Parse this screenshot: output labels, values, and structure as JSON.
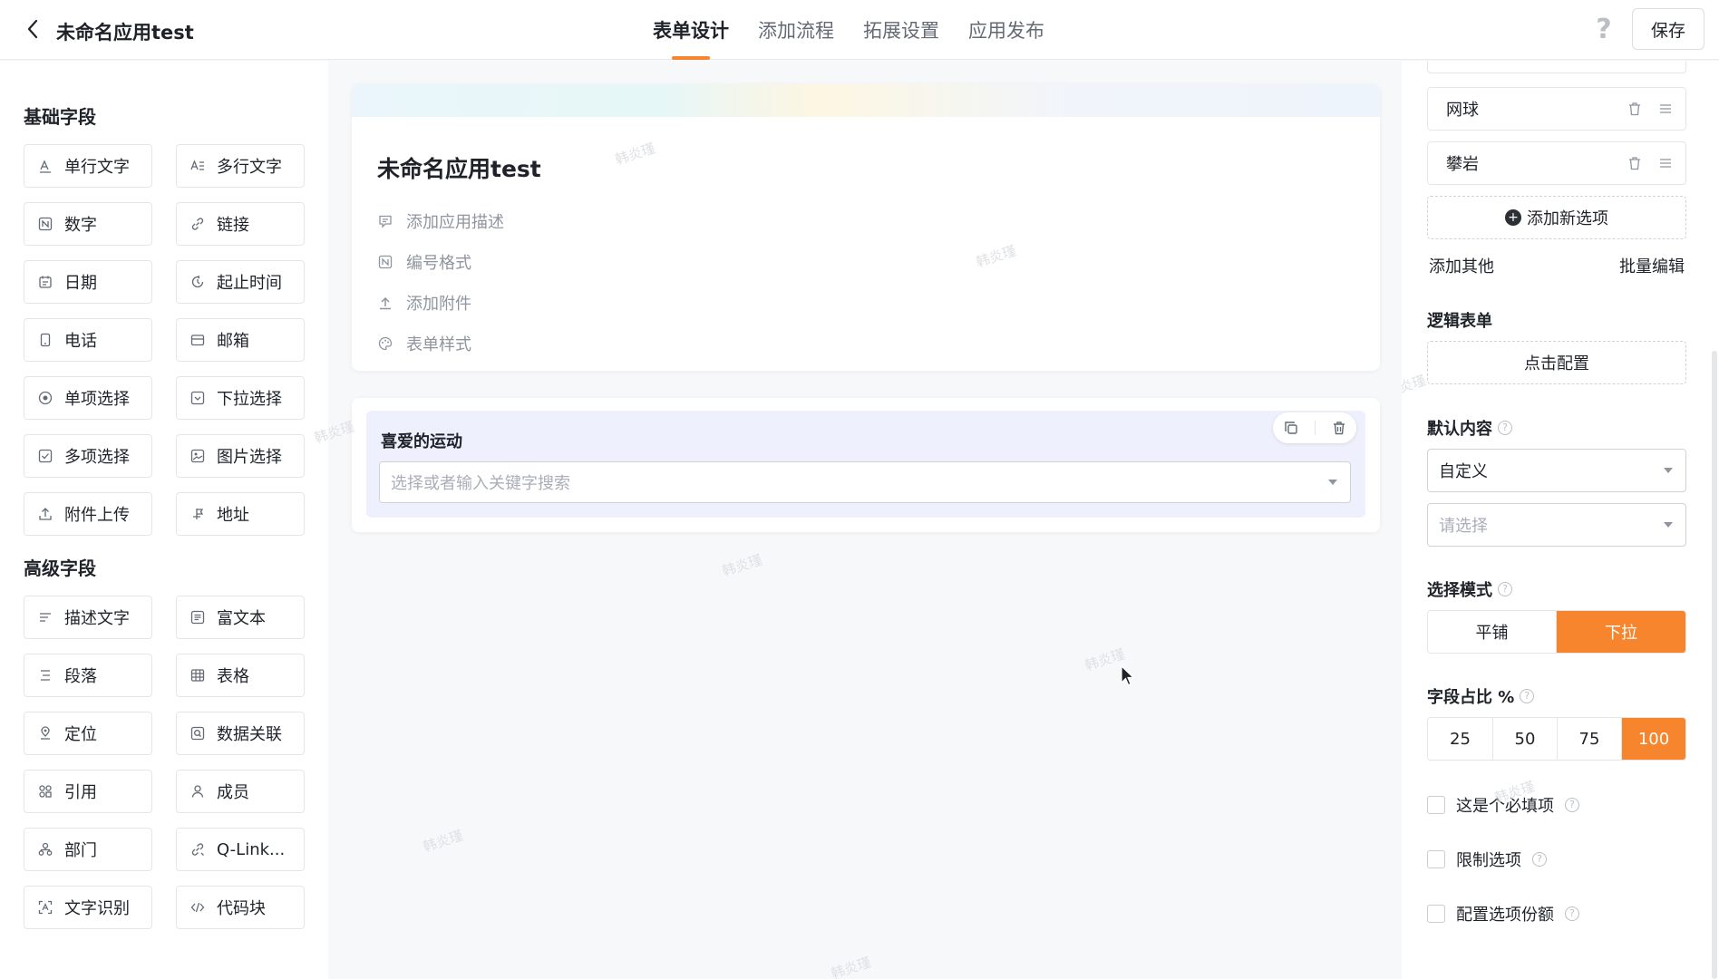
{
  "header": {
    "app_title": "未命名应用test",
    "tabs": [
      {
        "label": "表单设计",
        "active": true
      },
      {
        "label": "添加流程",
        "active": false
      },
      {
        "label": "拓展设置",
        "active": false
      },
      {
        "label": "应用发布",
        "active": false
      }
    ],
    "help_label": "?",
    "save_label": "保存",
    "accent_color": "#f7852e"
  },
  "left_panel": {
    "basic_title": "基础字段",
    "basic_fields": [
      {
        "label": "单行文字",
        "icon": "single-line-text-icon"
      },
      {
        "label": "多行文字",
        "icon": "multi-line-text-icon"
      },
      {
        "label": "数字",
        "icon": "number-icon"
      },
      {
        "label": "链接",
        "icon": "link-icon"
      },
      {
        "label": "日期",
        "icon": "calendar-icon"
      },
      {
        "label": "起止时间",
        "icon": "time-range-icon"
      },
      {
        "label": "电话",
        "icon": "phone-icon"
      },
      {
        "label": "邮箱",
        "icon": "mail-icon"
      },
      {
        "label": "单项选择",
        "icon": "radio-icon"
      },
      {
        "label": "下拉选择",
        "icon": "dropdown-icon"
      },
      {
        "label": "多项选择",
        "icon": "checkbox-icon"
      },
      {
        "label": "图片选择",
        "icon": "image-icon"
      },
      {
        "label": "附件上传",
        "icon": "upload-icon"
      },
      {
        "label": "地址",
        "icon": "address-icon"
      }
    ],
    "advanced_title": "高级字段",
    "advanced_fields": [
      {
        "label": "描述文字",
        "icon": "description-icon"
      },
      {
        "label": "富文本",
        "icon": "rich-text-icon"
      },
      {
        "label": "段落",
        "icon": "paragraph-icon"
      },
      {
        "label": "表格",
        "icon": "table-icon"
      },
      {
        "label": "定位",
        "icon": "location-icon"
      },
      {
        "label": "数据关联",
        "icon": "data-link-icon"
      },
      {
        "label": "引用",
        "icon": "reference-icon"
      },
      {
        "label": "成员",
        "icon": "member-icon"
      },
      {
        "label": "部门",
        "icon": "department-icon"
      },
      {
        "label": "Q-Link...",
        "icon": "qlink-icon"
      },
      {
        "label": "文字识别",
        "icon": "ocr-icon"
      },
      {
        "label": "代码块",
        "icon": "code-icon"
      }
    ]
  },
  "canvas": {
    "form_title": "未命名应用test",
    "meta": [
      {
        "label": "添加应用描述",
        "icon": "comment-icon"
      },
      {
        "label": "编号格式",
        "icon": "number-format-icon"
      },
      {
        "label": "添加附件",
        "icon": "attachment-upload-icon"
      },
      {
        "label": "表单样式",
        "icon": "palette-icon"
      }
    ],
    "field": {
      "label": "喜爱的运动",
      "placeholder": "选择或者输入关键字搜索"
    },
    "watermark": "韩炎瑾"
  },
  "right_panel": {
    "options": [
      "网球",
      "攀岩"
    ],
    "add_option": "添加新选项",
    "add_other": "添加其他",
    "batch_edit": "批量编辑",
    "logic_title": "逻辑表单",
    "logic_button": "点击配置",
    "default_title": "默认内容",
    "default_value": "自定义",
    "default_placeholder": "请选择",
    "mode_title": "选择模式",
    "modes": [
      {
        "label": "平铺",
        "active": false
      },
      {
        "label": "下拉",
        "active": true
      }
    ],
    "ratio_title": "字段占比 %",
    "ratios": [
      {
        "label": "25",
        "active": false
      },
      {
        "label": "50",
        "active": false
      },
      {
        "label": "75",
        "active": false
      },
      {
        "label": "100",
        "active": true
      }
    ],
    "checks": [
      {
        "label": "这是个必填项",
        "checked": false
      },
      {
        "label": "限制选项",
        "checked": false
      },
      {
        "label": "配置选项份额",
        "checked": false
      }
    ],
    "help_mark": "?"
  }
}
